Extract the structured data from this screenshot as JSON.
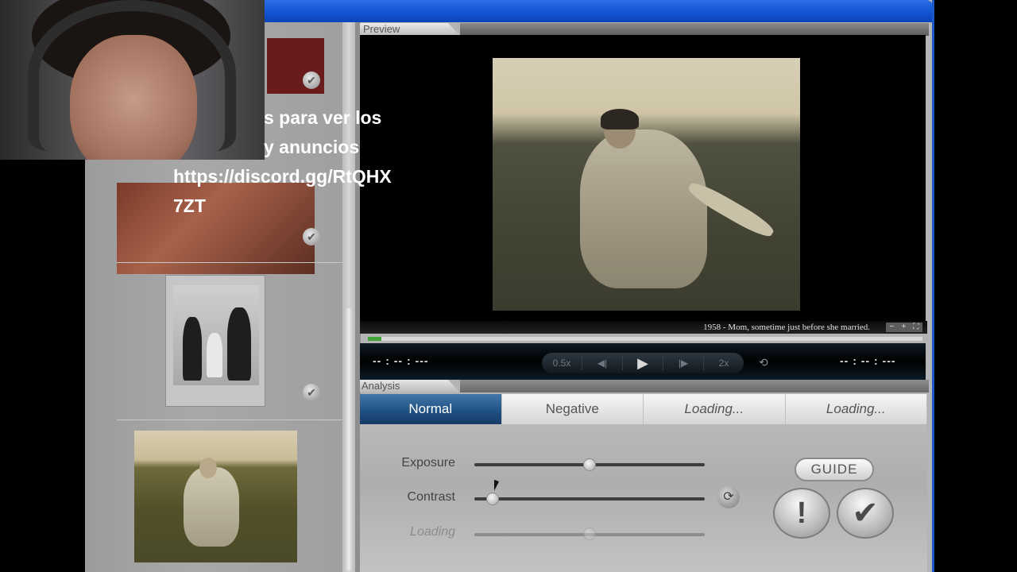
{
  "overlay": {
    "lines": [
      "s para ver los",
      "y anuncios",
      "https://discord.gg/RtQHX",
      "7ZT"
    ]
  },
  "preview": {
    "tab_label": "Preview",
    "caption": "1958 - Mom, sometime just before she married.",
    "zoom_minus": "−",
    "zoom_plus": "+",
    "zoom_fit": "⛶",
    "progress_fraction": 0.025,
    "time_left": "-- : -- : ---",
    "time_right": "-- : -- : ---",
    "transport": {
      "slow": "0.5x",
      "prev": "◀|",
      "play": "▶",
      "next": "|▶",
      "fast": "2x",
      "loop": "⟲"
    }
  },
  "analysis": {
    "tab_label": "Analysis",
    "tabs": [
      {
        "label": "Normal",
        "active": true,
        "italic": false
      },
      {
        "label": "Negative",
        "active": false,
        "italic": false
      },
      {
        "label": "Loading...",
        "active": false,
        "italic": true
      },
      {
        "label": "Loading...",
        "active": false,
        "italic": true
      }
    ],
    "sliders": [
      {
        "label": "Exposure",
        "value": 0.5,
        "dim": false
      },
      {
        "label": "Contrast",
        "value": 0.08,
        "dim": false
      },
      {
        "label": "Loading",
        "value": 0.5,
        "dim": true
      }
    ],
    "reset_icon": "⟳",
    "guide_label": "GUIDE",
    "alert_label": "!",
    "confirm_label": "✔"
  },
  "thumbnails": {
    "check": "✔"
  }
}
